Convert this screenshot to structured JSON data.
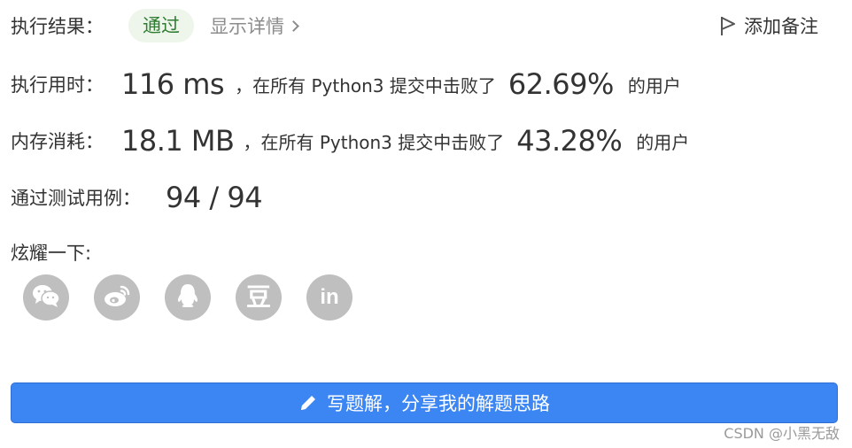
{
  "header": {
    "result_label": "执行结果：",
    "status": "通过",
    "details_link": "显示详情",
    "add_note": "添加备注"
  },
  "runtime": {
    "label": "执行用时：",
    "value": "116 ms",
    "middle_text": "，在所有 Python3 提交中击败了",
    "percent": "62.69%",
    "suffix": "的用户"
  },
  "memory": {
    "label": "内存消耗：",
    "value": "18.1 MB",
    "middle_text": "，在所有 Python3 提交中击败了",
    "percent": "43.28%",
    "suffix": "的用户"
  },
  "tests": {
    "label": "通过测试用例：",
    "value": "94 / 94"
  },
  "share": {
    "label": "炫耀一下:",
    "buttons": [
      {
        "icon": "wechat-icon"
      },
      {
        "icon": "weibo-icon"
      },
      {
        "icon": "qq-icon"
      },
      {
        "icon": "douban-icon",
        "glyph": "豆"
      },
      {
        "icon": "linkedin-icon",
        "glyph": "in"
      }
    ]
  },
  "solution_button": "写题解，分享我的解题思路",
  "watermark": "CSDN @小黑无敌",
  "colors": {
    "accent_blue": "#3c86f4",
    "success_green": "#2e7d32",
    "success_bg": "#eef5ea",
    "icon_gray": "#bfbfbf"
  }
}
